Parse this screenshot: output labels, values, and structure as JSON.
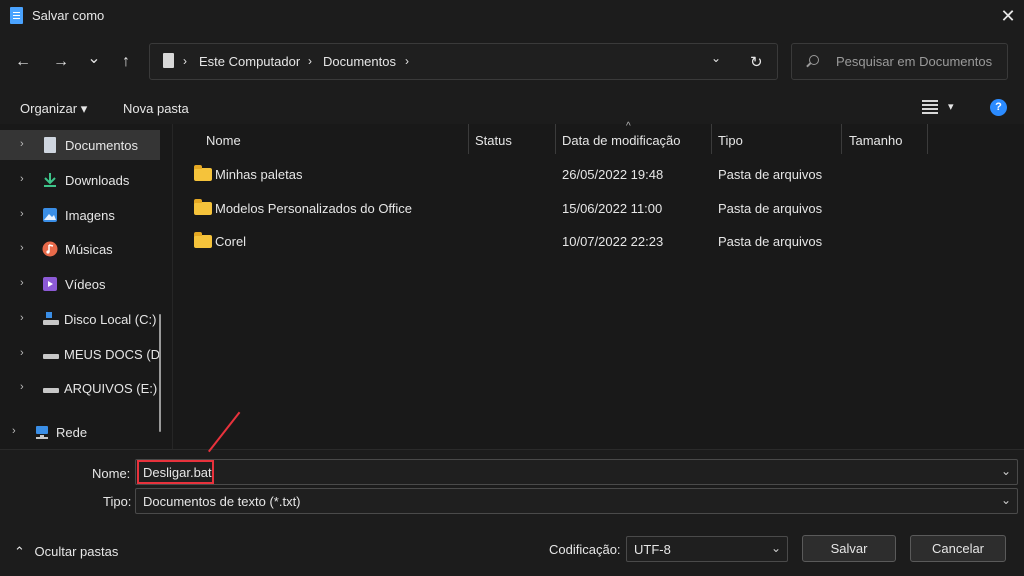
{
  "window": {
    "title": "Salvar como",
    "close_glyph": "✕"
  },
  "nav": {
    "back_glyph": "←",
    "forward_glyph": "→",
    "recent_glyph": "⌄",
    "up_glyph": "↑",
    "address": {
      "segments": [
        "Este Computador",
        "Documentos"
      ],
      "separator": "›",
      "dropdown_glyph": "⌄",
      "refresh_glyph": "↻"
    },
    "search": {
      "placeholder": "Pesquisar em Documentos"
    }
  },
  "toolbar": {
    "organize_label": "Organizar ▾",
    "new_folder_label": "Nova pasta",
    "view_caret": "▾",
    "help_glyph": "?"
  },
  "sidebar": {
    "items": [
      {
        "label": "Documentos",
        "icon": "document-icon",
        "selected": true
      },
      {
        "label": "Downloads",
        "icon": "download-icon"
      },
      {
        "label": "Imagens",
        "icon": "image-icon"
      },
      {
        "label": "Músicas",
        "icon": "music-icon"
      },
      {
        "label": "Vídeos",
        "icon": "video-icon"
      },
      {
        "label": "Disco Local (C:)",
        "icon": "drive-icon"
      },
      {
        "label": "MEUS DOCS (D",
        "icon": "drive-icon"
      },
      {
        "label": "ARQUIVOS (E:)",
        "icon": "drive-icon"
      },
      {
        "label": "Rede",
        "icon": "network-icon"
      }
    ],
    "chevron": "›"
  },
  "file_list": {
    "columns": [
      "Nome",
      "Status",
      "Data de modificação",
      "Tipo",
      "Tamanho"
    ],
    "sort_caret": "^",
    "rows": [
      {
        "name": "Minhas paletas",
        "status": "",
        "modified": "26/05/2022 19:48",
        "type": "Pasta de arquivos",
        "size": ""
      },
      {
        "name": "Modelos Personalizados do Office",
        "status": "",
        "modified": "15/06/2022 11:00",
        "type": "Pasta de arquivos",
        "size": ""
      },
      {
        "name": "Corel",
        "status": "",
        "modified": "10/07/2022 22:23",
        "type": "Pasta de arquivos",
        "size": ""
      }
    ]
  },
  "form": {
    "name_label": "Nome:",
    "name_value": "Desligar.bat",
    "type_label": "Tipo:",
    "type_value": "Documentos de texto (*.txt)",
    "encoding_label": "Codificação:",
    "encoding_value": "UTF-8",
    "caret": "⌄"
  },
  "footer": {
    "hide_folders_label": "Ocultar pastas",
    "hide_caret": "⌃",
    "save_label": "Salvar",
    "cancel_label": "Cancelar"
  },
  "colors": {
    "accent": "#2b8bff",
    "highlight": "#e8323c",
    "folder": "#f5c33b"
  }
}
